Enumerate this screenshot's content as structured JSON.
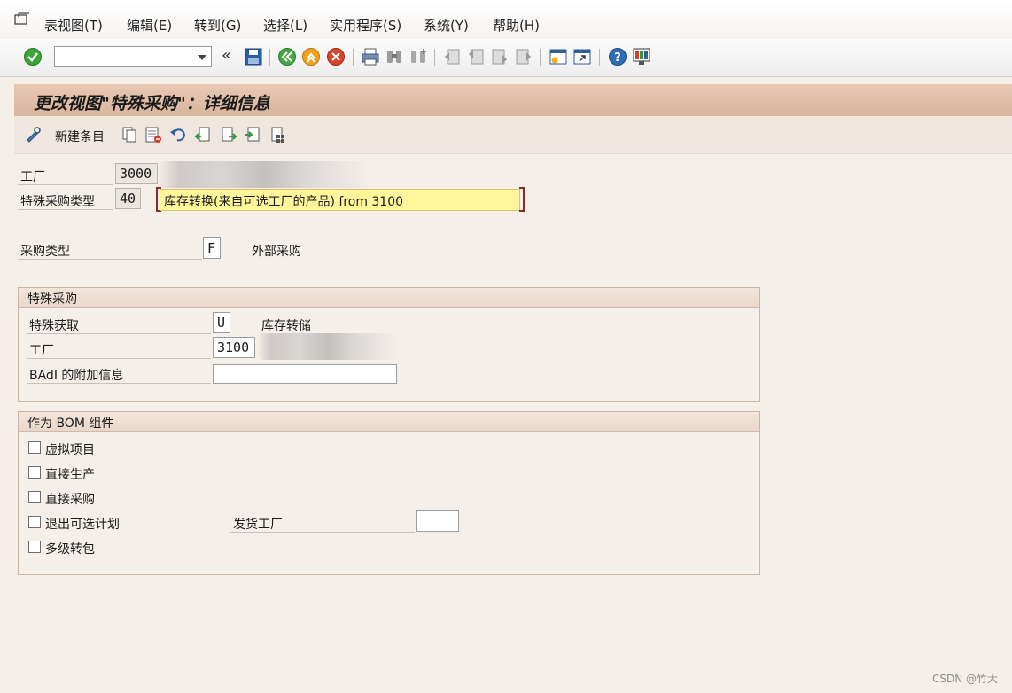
{
  "menubar": {
    "items": [
      "表视图(T)",
      "编辑(E)",
      "转到(G)",
      "选择(L)",
      "实用程序(S)",
      "系统(Y)",
      "帮助(H)"
    ]
  },
  "toolbar": {
    "command_field": {
      "value": ""
    },
    "icons": [
      "enter-icon",
      "back-icon",
      "save-icon",
      "nav-back-icon",
      "exit-icon",
      "cancel-icon",
      "print-icon",
      "find-icon",
      "find-next-icon",
      "first-page-icon",
      "prev-page-icon",
      "next-page-icon",
      "last-page-icon",
      "new-session-icon",
      "shortcut-icon",
      "help-icon",
      "customize-icon"
    ]
  },
  "title": "更改视图\"特殊采购\"：详细信息",
  "app_toolbar": {
    "new_entries_label": "新建条目"
  },
  "header": {
    "plant_label": "工厂",
    "plant_value": "3000",
    "special_proc_type_label": "特殊采购类型",
    "special_proc_type_value": "40",
    "special_proc_type_desc": "库存转换(来自可选工厂的产品) from 3100"
  },
  "procurement": {
    "type_label": "采购类型",
    "type_value": "F",
    "type_desc": "外部采购"
  },
  "special_procurement_group": {
    "title": "特殊采购",
    "special_proc_label": "特殊获取",
    "special_proc_value": "U",
    "special_proc_desc": "库存转储",
    "plant_label": "工厂",
    "plant_value": "3100",
    "badi_label": "BAdI 的附加信息",
    "badi_value": ""
  },
  "bom_group": {
    "title": "作为 BOM 组件",
    "checkboxes": [
      "虚拟项目",
      "直接生产",
      "直接采购",
      "退出可选计划",
      "多级转包"
    ],
    "issuing_plant_label": "发货工厂",
    "issuing_plant_value": ""
  },
  "watermark": "CSDN @竹大",
  "colors": {
    "title_bg": "#ddbca4",
    "tooltip_bg": "#fff59b",
    "page_bg": "#f5efe9"
  }
}
